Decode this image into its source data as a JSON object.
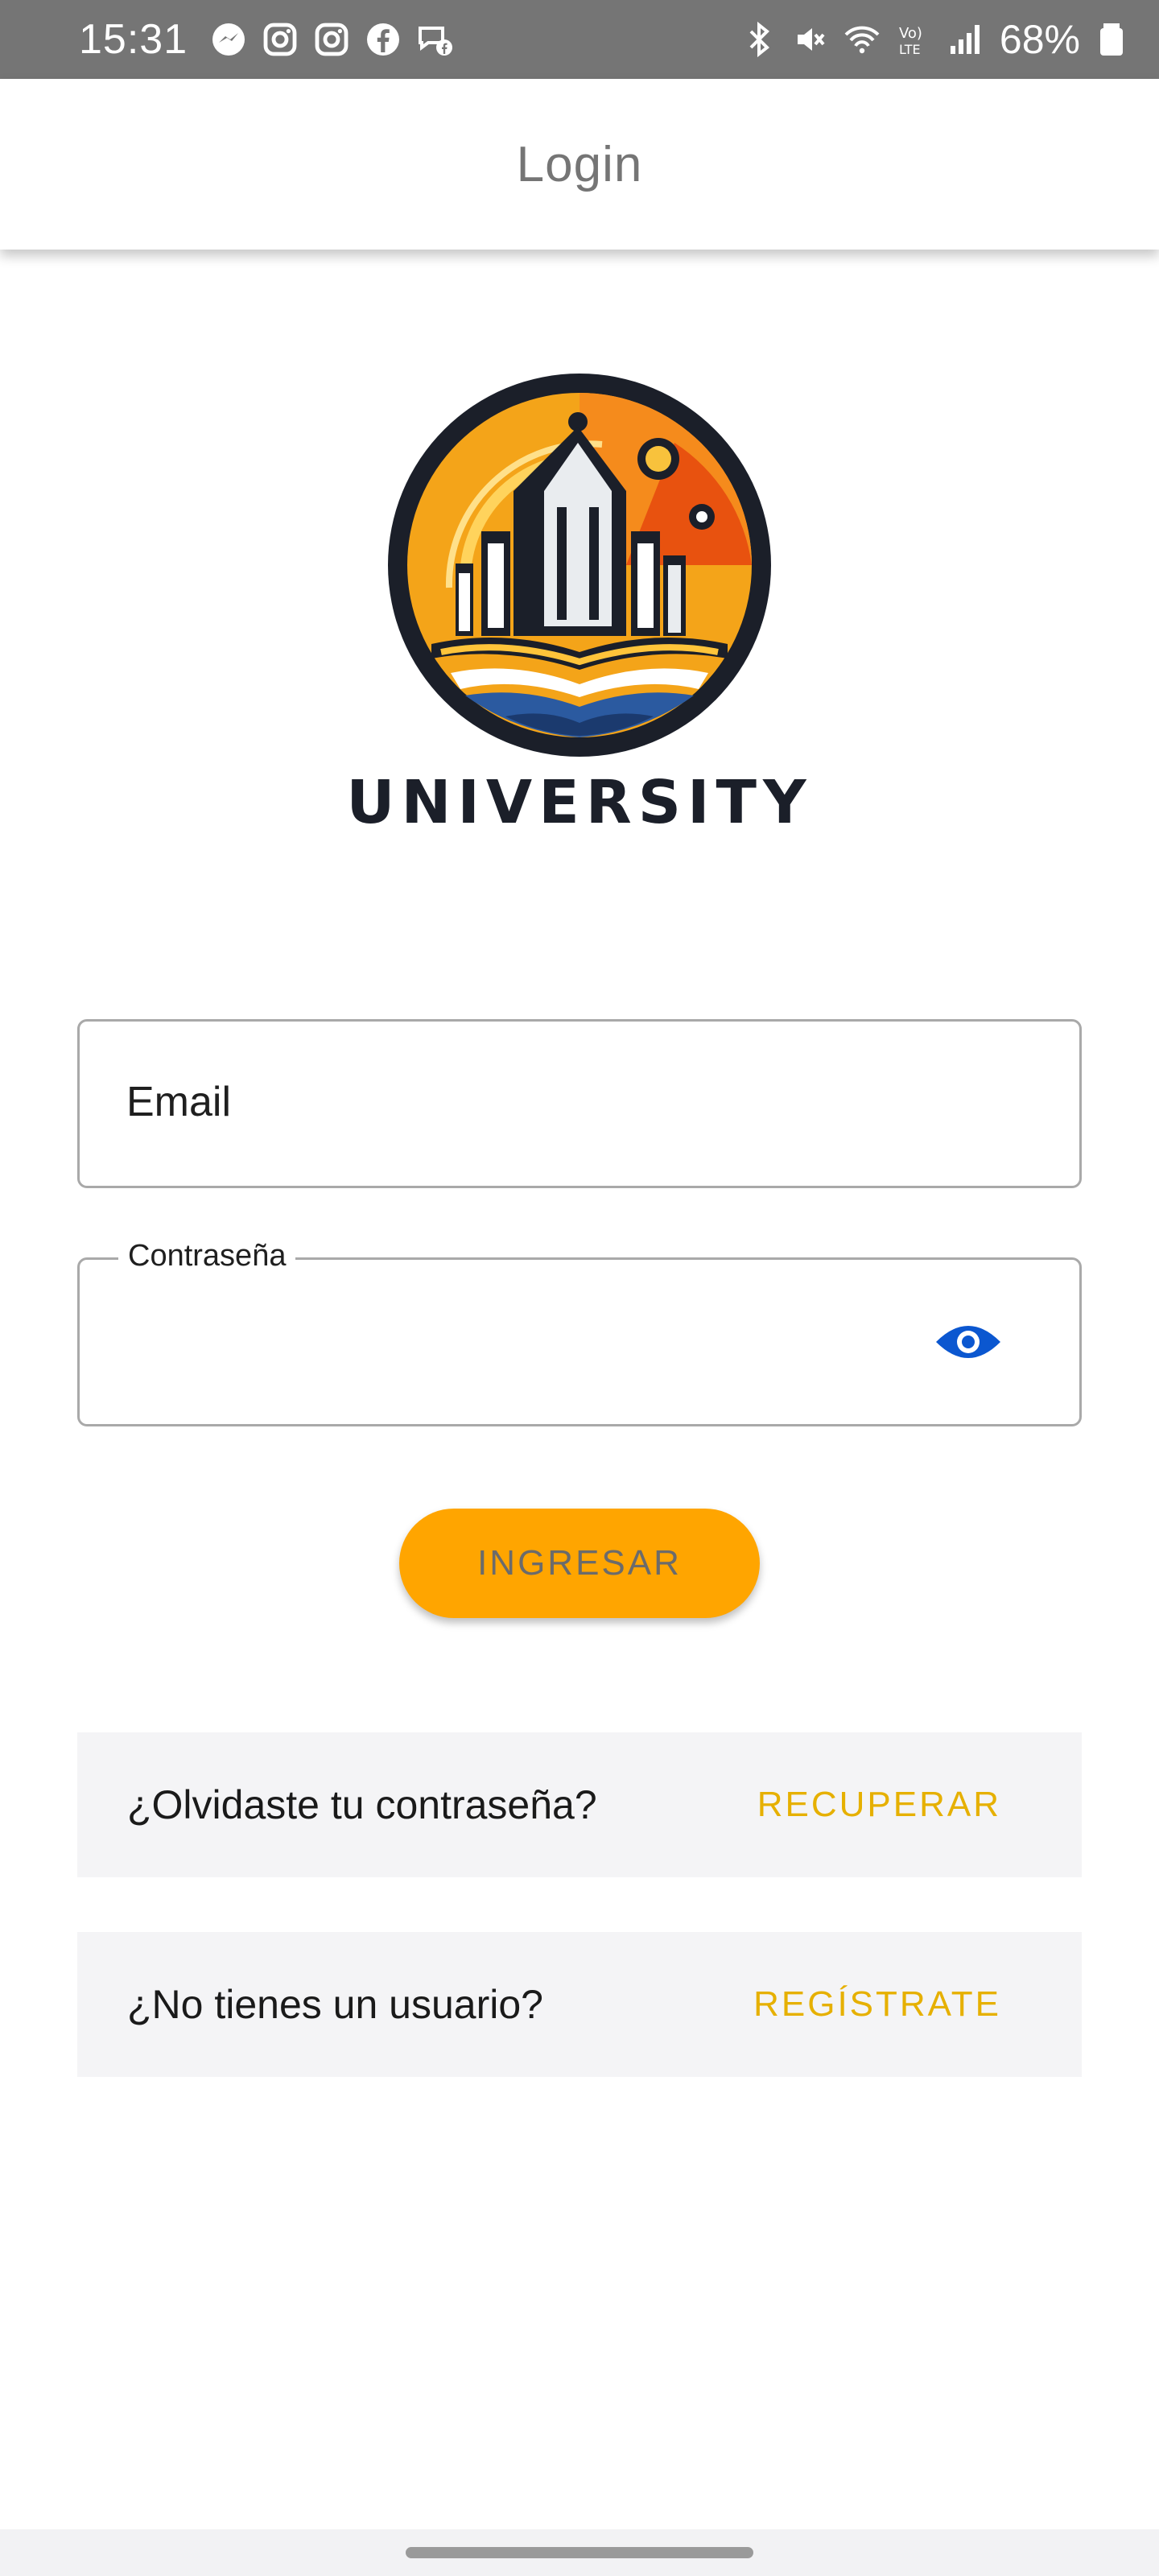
{
  "status_bar": {
    "time": "15:31",
    "notification_icons": [
      "messenger-icon",
      "instagram-icon",
      "instagram-icon",
      "facebook-icon",
      "facebook-chat-icon"
    ],
    "system_icons": [
      "bluetooth-icon",
      "mute-icon",
      "wifi-icon",
      "volte-icon",
      "signal-icon"
    ],
    "battery": "68%"
  },
  "app_bar": {
    "title": "Login"
  },
  "logo": {
    "text": "UNIVERSITY",
    "colors": {
      "ring": "#1b1f29",
      "orange": "#f39c12",
      "deep_orange": "#e8520f",
      "blue": "#2b5aa0"
    }
  },
  "form": {
    "email_placeholder": "Email",
    "password_label": "Contraseña",
    "eye_icon": "eye-icon",
    "eye_color": "#0b57d0"
  },
  "login_button": {
    "label": "INGRESAR",
    "color": "#ffa500"
  },
  "links": {
    "forgot": {
      "question": "¿Olvidaste tu contraseña?",
      "action": "RECUPERAR"
    },
    "register": {
      "question": "¿No tienes un usuario?",
      "action": "REGÍSTRATE"
    },
    "action_color": "#e6b000"
  }
}
